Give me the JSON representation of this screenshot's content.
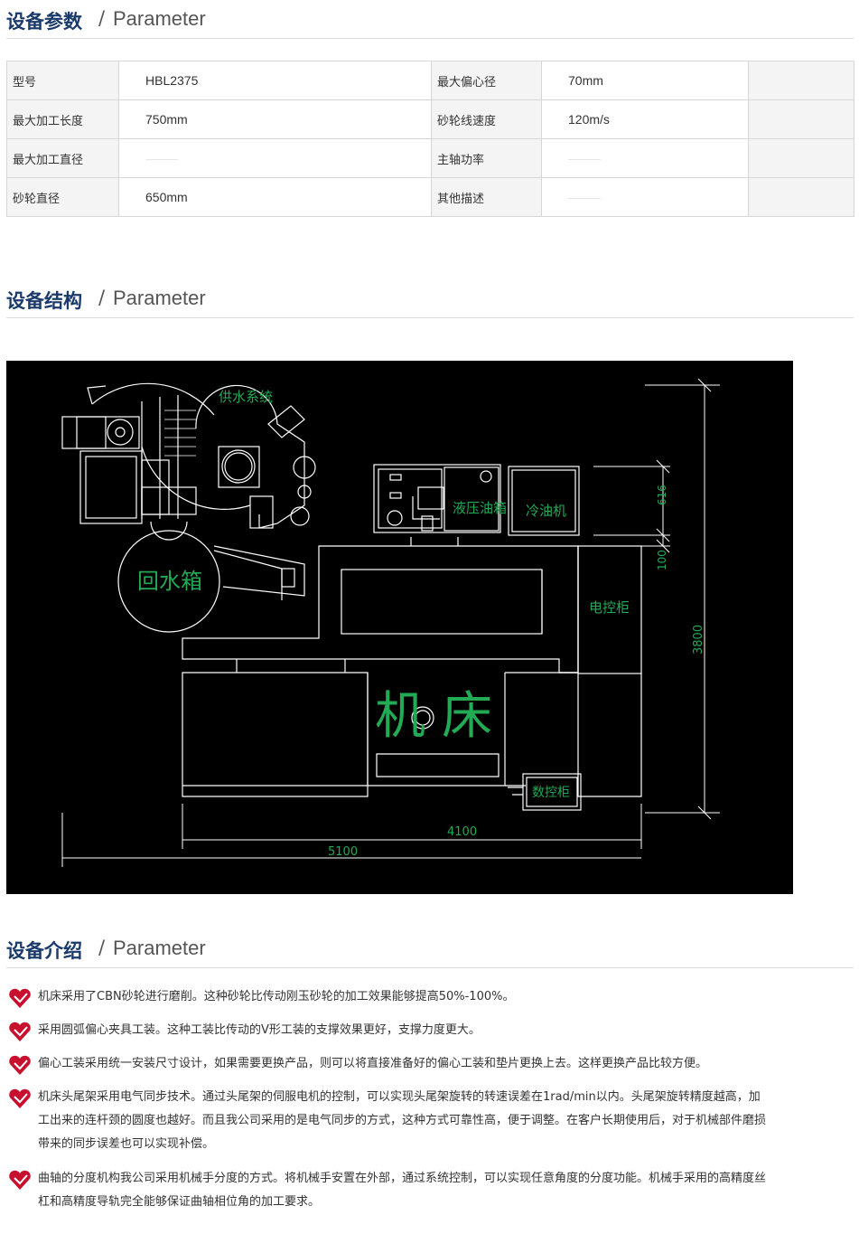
{
  "sections": {
    "params": {
      "title_cn": "设备参数",
      "slash": "/",
      "title_en": "Parameter"
    },
    "structure": {
      "title_cn": "设备结构",
      "slash": "/",
      "title_en": "Parameter"
    },
    "intro": {
      "title_cn": "设备介绍",
      "slash": "/",
      "title_en": "Parameter"
    }
  },
  "params_table": {
    "rows": [
      {
        "label1": "型号",
        "value1": "HBL2375",
        "label2": "最大偏心径",
        "value2": "70mm"
      },
      {
        "label1": "最大加工长度",
        "value1": "750mm",
        "label2": "砂轮线速度",
        "value2": "120m/s"
      },
      {
        "label1": "最大加工直径",
        "value1": "",
        "label2": "主轴功率",
        "value2": ""
      },
      {
        "label1": "砂轮直径",
        "value1": "650mm",
        "label2": "其他描述",
        "value2": ""
      }
    ]
  },
  "diagram": {
    "labels": {
      "water_supply": "供水系统",
      "return_tank": "回水箱",
      "hydraulic_tank": "液压油箱",
      "oil_cooler": "冷油机",
      "electric_cabinet": "电控柜",
      "machine_char1": "机",
      "machine_char2": "床",
      "cnc_cabinet": "数控柜"
    },
    "dims": {
      "d616": "616",
      "d100": "100",
      "d3800": "3800",
      "d4100": "4100",
      "d5100": "5100"
    },
    "colors": {
      "line": "#ffffff",
      "text": "#22aa55",
      "background": "#000000"
    }
  },
  "intro_items": [
    {
      "icon": "red-heart-arrow-icon",
      "text": "机床采用了CBN砂轮进行磨削。这种砂轮比传动刚玉砂轮的加工效果能够提高50%-100%。"
    },
    {
      "icon": "red-heart-arrow-icon",
      "text": "采用圆弧偏心夹具工装。这种工装比传动的V形工装的支撑效果更好，支撑力度更大。"
    },
    {
      "icon": "red-heart-arrow-icon",
      "text": "偏心工装采用统一安装尺寸设计，如果需要更换产品，则可以将直接准备好的偏心工装和垫片更换上去。这样更换产品比较方便。"
    },
    {
      "icon": "red-heart-arrow-icon",
      "text": "机床头尾架采用电气同步技术。通过头尾架的伺服电机的控制，可以实现头尾架旋转的转速误差在1rad/min以内。头尾架旋转精度越高，加工出来的连杆颈的圆度也越好。而且我公司采用的是电气同步的方式，这种方式可靠性高，便于调整。在客户长期使用后，对于机械部件磨损带来的同步误差也可以实现补偿。"
    },
    {
      "icon": "red-heart-arrow-icon",
      "text": "曲轴的分度机构我公司采用机械手分度的方式。将机械手安置在外部，通过系统控制，可以实现任意角度的分度功能。机械手采用的高精度丝杠和高精度导轨完全能够保证曲轴相位角的加工要求。"
    }
  ]
}
